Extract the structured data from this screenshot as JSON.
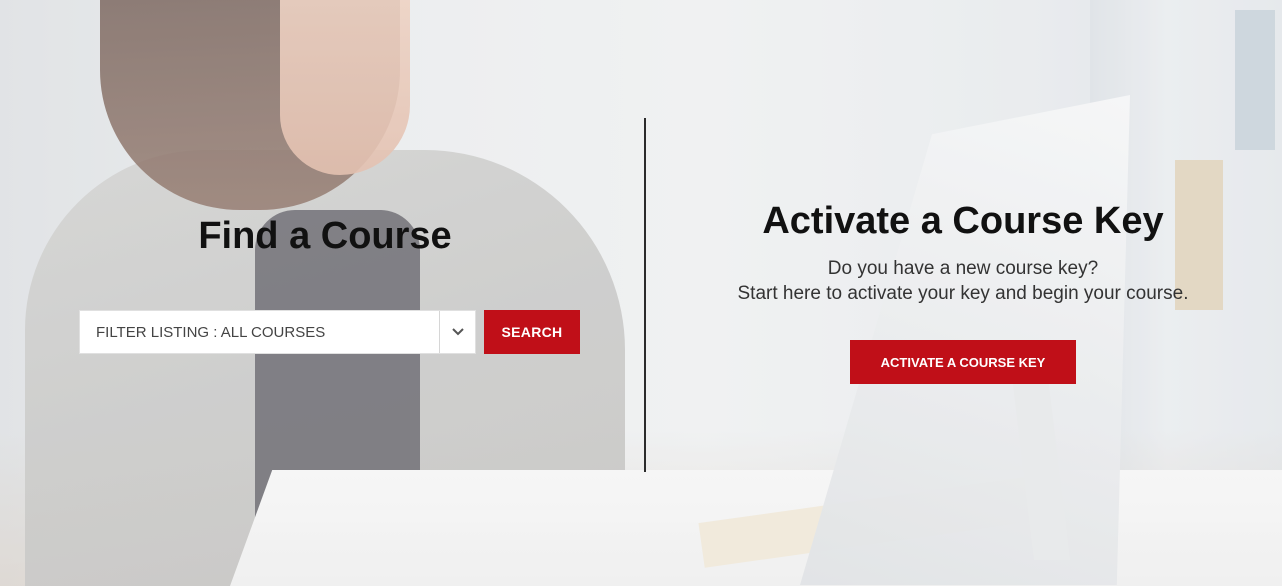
{
  "find": {
    "title": "Find a Course",
    "filter_value": "FILTER LISTING : ALL COURSES",
    "search_label": "SEARCH"
  },
  "activate": {
    "title": "Activate a Course Key",
    "subtitle_line1": "Do you have a new course key?",
    "subtitle_line2": "Start here to activate your key and begin your course.",
    "button_label": "ACTIVATE A COURSE KEY"
  },
  "colors": {
    "accent": "#c00f18",
    "text": "#111111"
  },
  "icons": {
    "dropdown": "chevron-down-icon"
  }
}
